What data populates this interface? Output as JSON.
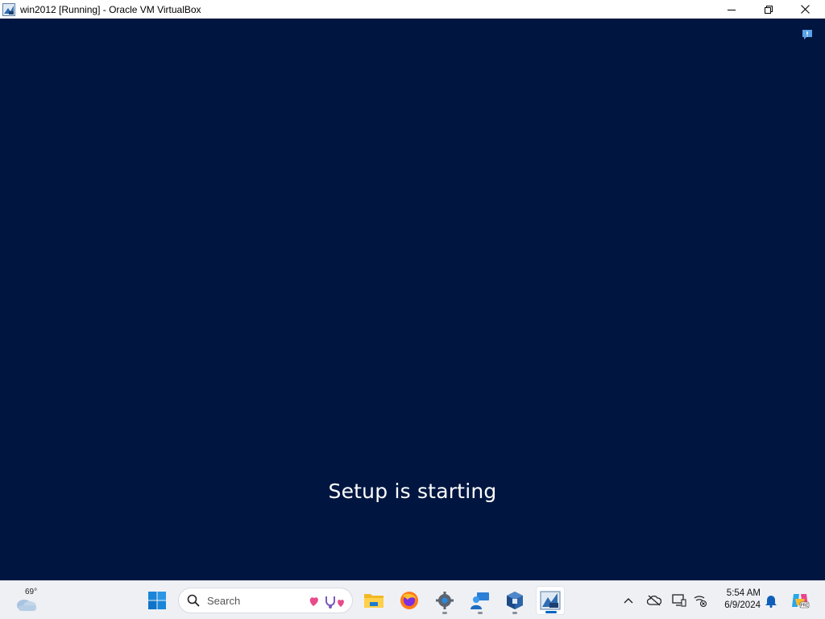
{
  "window": {
    "title": "win2012 [Running] - Oracle VM VirtualBox",
    "icon": "virtualbox-vm-icon"
  },
  "vm": {
    "message": "Setup is starting",
    "background_color": "#001641"
  },
  "taskbar": {
    "weather": {
      "temperature": "69°",
      "icon": "cloud-icon"
    },
    "search": {
      "placeholder": "Search"
    },
    "apps": [
      {
        "name": "start",
        "icon": "windows-start-icon"
      },
      {
        "name": "file-explorer",
        "icon": "folder-icon"
      },
      {
        "name": "firefox",
        "icon": "firefox-icon"
      },
      {
        "name": "settings",
        "icon": "gear-icon"
      },
      {
        "name": "remote-desktop",
        "icon": "remote-desktop-icon"
      },
      {
        "name": "virtualbox",
        "icon": "virtualbox-icon"
      },
      {
        "name": "win2012-vm",
        "icon": "vm-window-icon",
        "active": true
      }
    ],
    "tray": {
      "time": "5:54 AM",
      "date": "6/9/2024"
    }
  }
}
